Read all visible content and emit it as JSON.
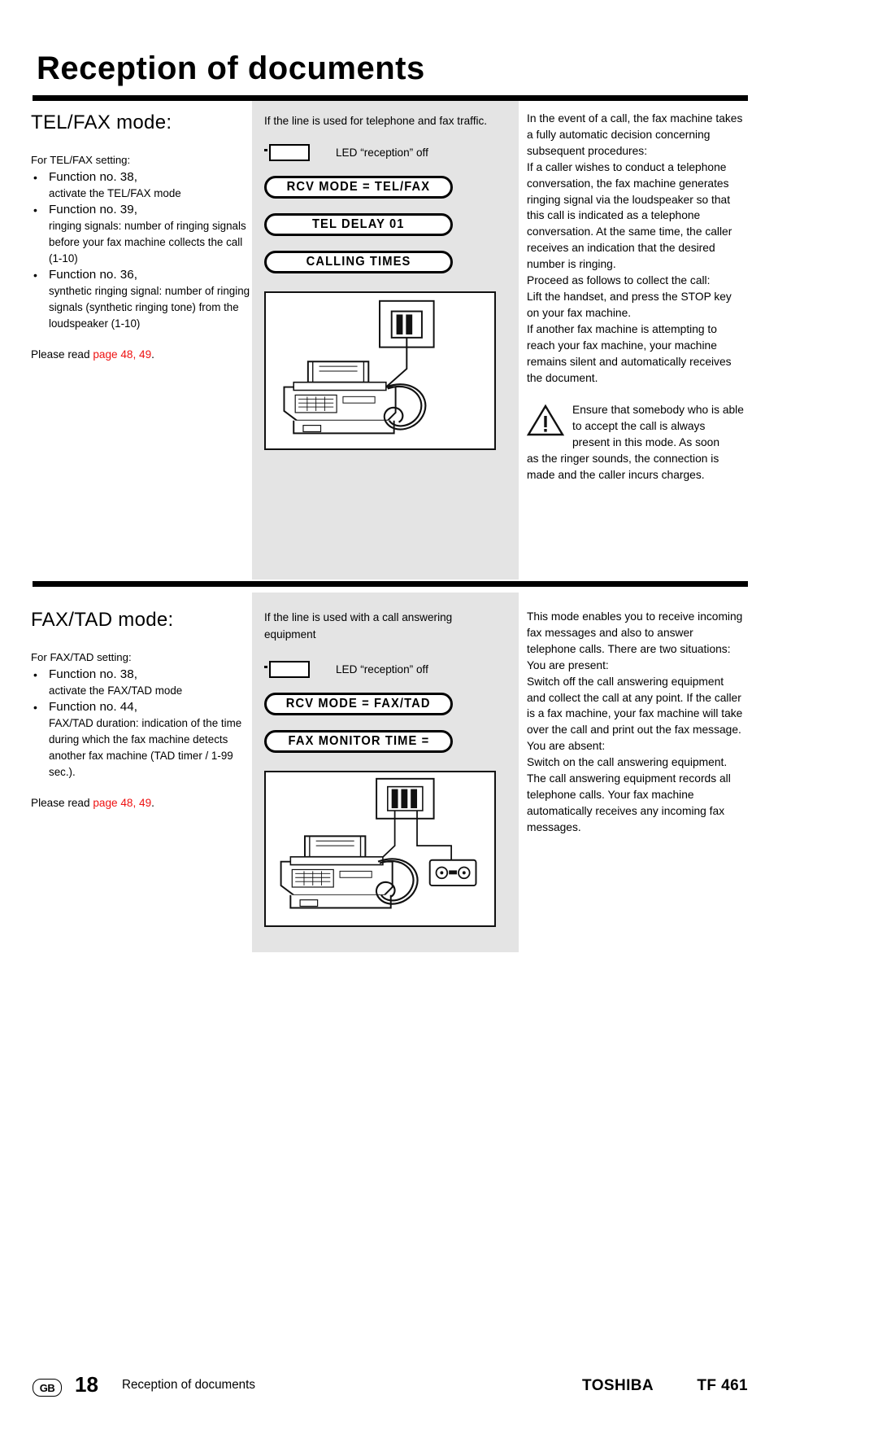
{
  "header": {
    "title": "Reception of documents"
  },
  "sections": [
    {
      "id": "telfax",
      "heading": "TEL/FAX mode:",
      "settings_lead": "For TEL/FAX setting:",
      "functions": [
        {
          "title": "Function no. 38,",
          "desc": "activate the TEL/FAX mode"
        },
        {
          "title": "Function no. 39,",
          "desc": "ringing signals: number of ringing signals before your fax machine collects the call (1-10)"
        },
        {
          "title": "Function no. 36,",
          "desc": "synthetic ringing signal: number of ringing signals (synthetic ringing tone) from the loudspeaker (1-10)"
        }
      ],
      "please_read_prefix": "Please read ",
      "please_read_link": "page 48, 49",
      "please_read_suffix": ".",
      "mid_intro": "If the line is used for telephone and fax traffic.",
      "led_label": "LED “reception” off",
      "displays": [
        "RCV MODE  =  TEL/FAX",
        "TEL DELAY        01",
        "CALLING TIMES"
      ],
      "illustration_name": "fax-machine-with-handset-and-wall-socket",
      "right_paragraphs": [
        "In the event of a call, the fax machine takes a fully automatic decision concerning subsequent procedures:",
        "If a caller wishes to conduct a telephone conversation, the fax machine generates ringing signal via the loudspeaker so that this call is indicated as a telephone conversation. At the same time, the caller receives an indication that the desired number is ringing.",
        "Proceed as follows to collect the call:",
        "Lift the handset, and press the STOP key on your fax machine.",
        "If another fax machine is attempting to reach your fax machine, your machine remains silent and automatically receives the document."
      ],
      "warning_text_top": "Ensure that somebody who is able to accept the call is always present in this mode. As soon",
      "warning_text_bottom": "as the ringer sounds, the connection is made and the caller incurs charges."
    },
    {
      "id": "faxtad",
      "heading": "FAX/TAD mode:",
      "settings_lead": "For FAX/TAD setting:",
      "functions": [
        {
          "title": "Function no. 38,",
          "desc": "activate the FAX/TAD mode"
        },
        {
          "title": "Function no. 44,",
          "desc": "FAX/TAD duration: indication of the time during which the fax machine detects another fax machine (TAD timer / 1-99 sec.)."
        }
      ],
      "please_read_prefix": "Please read ",
      "please_read_link": "page 48, 49",
      "please_read_suffix": ".",
      "mid_intro": "If the line is used with a call answering equipment",
      "led_label": "LED “reception” off",
      "displays": [
        "RCV MODE  =  FAX/TAD",
        "FAX MONITOR TIME ="
      ],
      "illustration_name": "fax-machine-with-handset-and-answering-machine",
      "right_paragraphs": [
        "This mode enables you to receive incoming fax messages and also to answer telephone calls. There are two situations:"
      ],
      "present_head": "You are present:",
      "present_body": "Switch off the call answering equipment and collect the call at any point. If the caller is a fax machine, your fax machine will take over the call and print out the fax message.",
      "absent_head": "You are absent:",
      "absent_body": "Switch on the call answering equipment. The call answering equipment records all telephone calls. Your fax machine automatically receives any incoming fax messages."
    }
  ],
  "footer": {
    "locale_badge": "GB",
    "page_number": "18",
    "title": "Reception of documents",
    "brand": "TOSHIBA",
    "model": "TF 461"
  },
  "colors": {
    "link_red": "#ee1111",
    "panel_gray": "#e4e4e4",
    "rule_black": "#000000"
  }
}
